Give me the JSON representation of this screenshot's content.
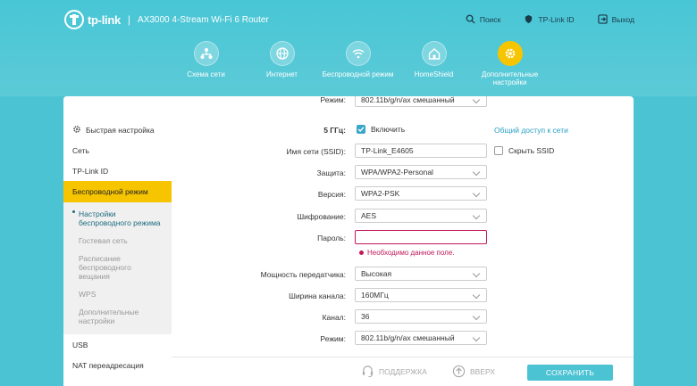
{
  "header": {
    "brand": "tp-link",
    "separator": "|",
    "model": "AX3000 4-Stream Wi-Fi 6 Router",
    "links": {
      "search": "Поиск",
      "tplink_id": "TP-Link ID",
      "logout": "Выход"
    }
  },
  "nav": {
    "items": [
      {
        "label": "Схема сети",
        "icon": "network-map-icon"
      },
      {
        "label": "Интернет",
        "icon": "globe-icon"
      },
      {
        "label": "Беспроводной режим",
        "icon": "wifi-icon"
      },
      {
        "label": "HomeShield",
        "icon": "home-shield-icon"
      },
      {
        "label": "Дополнительные настройки",
        "icon": "gear-icon"
      }
    ],
    "active_color": "#f7c500"
  },
  "sidebar": {
    "quick_setup": "Быстрая настройка",
    "network": "Сеть",
    "tplink_id": "TP-Link ID",
    "wireless": "Беспроводной режим",
    "sub": {
      "wireless_settings": "Настройки беспроводного режима",
      "guest": "Гостевая сеть",
      "schedule": "Расписание беспроводного вещания",
      "wps": "WPS",
      "advanced": "Дополнительные настройки"
    },
    "usb": "USB",
    "nat": "NAT переадресация"
  },
  "form": {
    "top_mode_label": "Режим:",
    "top_mode_value": "802.11b/g/n/ax смешанный",
    "band_label": "5 ГГц:",
    "enable_label": "Включить",
    "share_link": "Общий доступ к сети",
    "ssid_label": "Имя сети (SSID):",
    "ssid_value": "TP-Link_E4605",
    "hide_ssid_label": "Скрыть SSID",
    "security_label": "Защита:",
    "security_value": "WPA/WPA2-Personal",
    "version_label": "Версия:",
    "version_value": "WPA2-PSK",
    "encryption_label": "Шифрование:",
    "encryption_value": "AES",
    "password_label": "Пароль:",
    "password_value": "",
    "password_error": "Необходимо данное поле.",
    "power_label": "Мощность передатчика:",
    "power_value": "Высокая",
    "width_label": "Ширина канала:",
    "width_value": "160МГц",
    "channel_label": "Канал:",
    "channel_value": "36",
    "mode_label": "Режим:",
    "mode_value": "802.11b/g/n/ax смешанный"
  },
  "footer": {
    "support": "ПОДДЕРЖКА",
    "top": "ВВЕРХ",
    "save": "СОХРАНИТЬ"
  }
}
